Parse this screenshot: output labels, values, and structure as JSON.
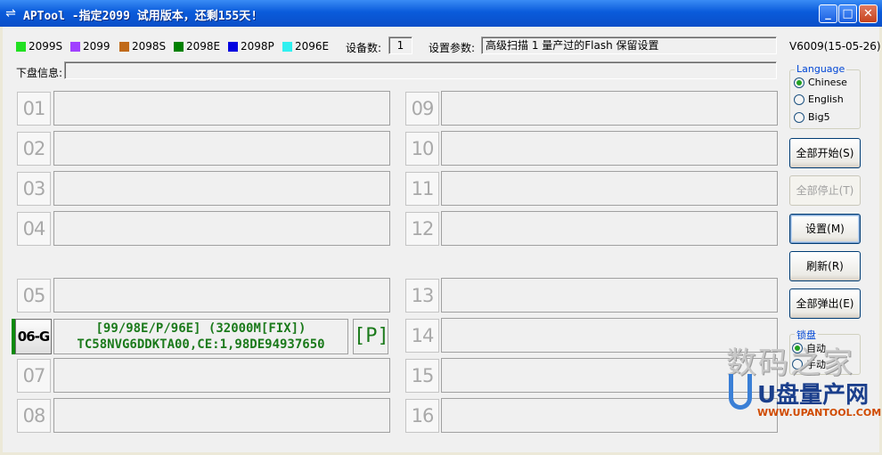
{
  "window": {
    "title": "APTool -指定2099 试用版本，还剩155天!",
    "minimize": "_",
    "maximize": "□",
    "close": "✕"
  },
  "legend": [
    {
      "label": "2099S",
      "color": "#22e022"
    },
    {
      "label": "2099",
      "color": "#a040ff"
    },
    {
      "label": "2098S",
      "color": "#c06a1a"
    },
    {
      "label": "2098E",
      "color": "#008000"
    },
    {
      "label": "2098P",
      "color": "#0000e0"
    },
    {
      "label": "2096E",
      "color": "#30f0f0"
    }
  ],
  "device_count_label": "设备数:",
  "device_count": "1",
  "settings_label": "设置参数:",
  "settings_value": "高级扫描 1 量产过的Flash 保留设置",
  "version": "V6009(15-05-26)",
  "disk_info_label": "下盘信息:",
  "slots_left": [
    "01",
    "02",
    "03",
    "04",
    "05",
    "07",
    "08"
  ],
  "slots_right": [
    "09",
    "10",
    "11",
    "12",
    "13",
    "14",
    "15",
    "16"
  ],
  "active_slot": {
    "id": "06-G",
    "line1": "[99/98E/P/96E]  (32000M[FIX])",
    "line2": "TC58NVG6DDKTA00,CE:1,98DE94937650",
    "badge": "[P]"
  },
  "language": {
    "title": "Language",
    "options": [
      {
        "label": "Chinese",
        "selected": true
      },
      {
        "label": "English",
        "selected": false
      },
      {
        "label": "Big5",
        "selected": false
      }
    ]
  },
  "buttons": {
    "start_all": "全部开始(S)",
    "stop_all": "全部停止(T)",
    "settings": "设置(M)",
    "refresh": "刷新(R)",
    "eject_all": "全部弹出(E)"
  },
  "lock": {
    "title": "锁盘",
    "options": [
      {
        "label": "自动",
        "selected": true
      },
      {
        "label": "手动",
        "selected": false
      }
    ]
  },
  "watermark": {
    "text": "数码之家",
    "brand": "U盘量产网",
    "url": "WWW.UPANTOOL.COM"
  },
  "icons": {
    "app": "usb-icon"
  }
}
